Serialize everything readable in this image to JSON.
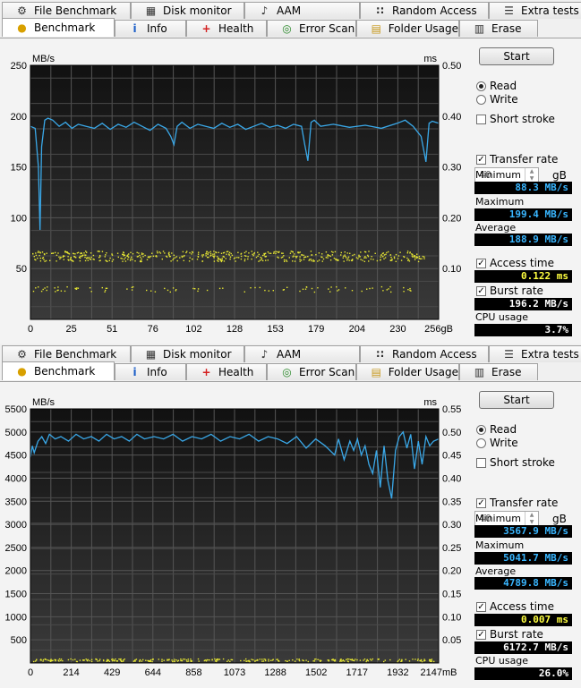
{
  "tabs_row1": [
    {
      "label": "File Benchmark",
      "icon": "file-benchmark-icon"
    },
    {
      "label": "Disk monitor",
      "icon": "disk-monitor-icon"
    },
    {
      "label": "AAM",
      "icon": "speaker-icon"
    },
    {
      "label": "Random Access",
      "icon": "random-access-icon"
    },
    {
      "label": "Extra tests",
      "icon": "extra-tests-icon"
    }
  ],
  "tabs_row2": [
    {
      "label": "Benchmark",
      "icon": "benchmark-icon",
      "active": true
    },
    {
      "label": "Info",
      "icon": "info-icon"
    },
    {
      "label": "Health",
      "icon": "health-cross-icon"
    },
    {
      "label": "Error Scan",
      "icon": "magnifier-icon"
    },
    {
      "label": "Folder Usage",
      "icon": "folder-icon"
    },
    {
      "label": "Erase",
      "icon": "trash-icon"
    }
  ],
  "colors": {
    "read_line": "#3aa8e8",
    "access_dots": "#e6e632",
    "plot_bg_top": "#111111",
    "plot_bg_bottom": "#3a3a3a",
    "grid": "#555555"
  },
  "panels": [
    {
      "side": {
        "start": "Start",
        "read": "Read",
        "write": "Write",
        "short_stroke": "Short stroke",
        "stroke_value": "40",
        "stroke_unit": "gB",
        "transfer_rate": "Transfer rate",
        "minimum_label": "Minimum",
        "minimum_value": "88.3 MB/s",
        "maximum_label": "Maximum",
        "maximum_value": "199.4 MB/s",
        "average_label": "Average",
        "average_value": "188.9 MB/s",
        "access_time_label": "Access time",
        "access_time_value": "0.122 ms",
        "burst_rate_label": "Burst rate",
        "burst_rate_value": "196.2 MB/s",
        "cpu_label": "CPU usage",
        "cpu_value": "3.7%"
      },
      "chart_data": {
        "type": "line",
        "ylabel_left": "MB/s",
        "ylabel_right": "ms",
        "left_ticks": [
          "250",
          "200",
          "150",
          "100",
          "50"
        ],
        "right_ticks": [
          "0.50",
          "0.40",
          "0.30",
          "0.20",
          "0.10"
        ],
        "ylim": [
          0,
          250
        ],
        "ylim_right": [
          0,
          0.5
        ],
        "x_ticks": [
          "0",
          "25",
          "51",
          "76",
          "102",
          "128",
          "153",
          "179",
          "204",
          "230",
          "256gB"
        ],
        "xlim": [
          0,
          256
        ],
        "series": [
          {
            "x": [
              0,
              3,
              5,
              6,
              7,
              9,
              11,
              14,
              18,
              22,
              26,
              30,
              35,
              40,
              45,
              50,
              55,
              60,
              65,
              70,
              75,
              80,
              85,
              88,
              90,
              92,
              95,
              100,
              105,
              110,
              115,
              120,
              125,
              130,
              135,
              140,
              145,
              150,
              155,
              160,
              165,
              170,
              172,
              174,
              176,
              178,
              182,
              190,
              200,
              210,
              220,
              230,
              235,
              240,
              245,
              248,
              250,
              252,
              256
            ],
            "y": [
              190,
              188,
              150,
              88,
              170,
              196,
              198,
              196,
              190,
              194,
              188,
              192,
              190,
              188,
              193,
              187,
              192,
              189,
              194,
              190,
              186,
              192,
              188,
              180,
              172,
              190,
              194,
              188,
              192,
              190,
              188,
              193,
              189,
              192,
              187,
              190,
              193,
              189,
              191,
              188,
              192,
              190,
              172,
              156,
              194,
              196,
              190,
              192,
              189,
              191,
              188,
              193,
              196,
              190,
              180,
              155,
              193,
              195,
              193
            ]
          }
        ],
        "access_bands": [
          {
            "y_ms": 0.13
          },
          {
            "y_ms": 0.12
          },
          {
            "y_ms": 0.06
          }
        ]
      }
    },
    {
      "side": {
        "start": "Start",
        "read": "Read",
        "write": "Write",
        "short_stroke": "Short stroke",
        "stroke_value": "40",
        "stroke_unit": "gB",
        "transfer_rate": "Transfer rate",
        "minimum_label": "Minimum",
        "minimum_value": "3567.9 MB/s",
        "maximum_label": "Maximum",
        "maximum_value": "5041.7 MB/s",
        "average_label": "Average",
        "average_value": "4789.8 MB/s",
        "access_time_label": "Access time",
        "access_time_value": "0.007 ms",
        "burst_rate_label": "Burst rate",
        "burst_rate_value": "6172.7 MB/s",
        "cpu_label": "CPU usage",
        "cpu_value": "26.0%"
      },
      "chart_data": {
        "type": "line",
        "ylabel_left": "MB/s",
        "ylabel_right": "ms",
        "left_ticks": [
          "5500",
          "5000",
          "4500",
          "4000",
          "3500",
          "3000",
          "2500",
          "2000",
          "1500",
          "1000",
          "500"
        ],
        "right_ticks": [
          "0.55",
          "0.50",
          "0.45",
          "0.40",
          "0.35",
          "0.30",
          "0.25",
          "0.20",
          "0.15",
          "0.10",
          "0.05"
        ],
        "ylim": [
          0,
          5500
        ],
        "ylim_right": [
          0,
          0.55
        ],
        "x_ticks": [
          "0",
          "214",
          "429",
          "644",
          "858",
          "1073",
          "1288",
          "1502",
          "1717",
          "1932",
          "2147mB"
        ],
        "xlim": [
          0,
          2147
        ],
        "series": [
          {
            "x": [
              0,
              10,
              20,
              40,
              60,
              80,
              100,
              130,
              160,
              200,
              240,
              280,
              320,
              360,
              400,
              440,
              480,
              520,
              560,
              600,
              650,
              700,
              750,
              800,
              850,
              900,
              950,
              1000,
              1050,
              1100,
              1150,
              1200,
              1250,
              1300,
              1350,
              1400,
              1450,
              1500,
              1550,
              1600,
              1620,
              1650,
              1680,
              1700,
              1720,
              1740,
              1760,
              1780,
              1800,
              1820,
              1840,
              1860,
              1880,
              1900,
              1920,
              1940,
              1960,
              1980,
              2000,
              2020,
              2040,
              2060,
              2080,
              2100,
              2120,
              2147
            ],
            "y": [
              4450,
              4700,
              4550,
              4800,
              4900,
              4750,
              4950,
              4850,
              4900,
              4800,
              4950,
              4850,
              4900,
              4800,
              4950,
              4850,
              4900,
              4800,
              4950,
              4850,
              4900,
              4850,
              4950,
              4800,
              4900,
              4850,
              4950,
              4800,
              4900,
              4850,
              4950,
              4800,
              4900,
              4850,
              4750,
              4900,
              4650,
              4850,
              4700,
              4500,
              4850,
              4400,
              4800,
              4600,
              4850,
              4500,
              4700,
              4300,
              4100,
              4600,
              3800,
              4700,
              3950,
              3560,
              4600,
              4900,
              5000,
              4650,
              4950,
              4200,
              4800,
              4300,
              4900,
              4700,
              4800,
              4850
            ]
          }
        ],
        "access_bands": [
          {
            "y_ms": 0.007
          }
        ]
      }
    }
  ]
}
